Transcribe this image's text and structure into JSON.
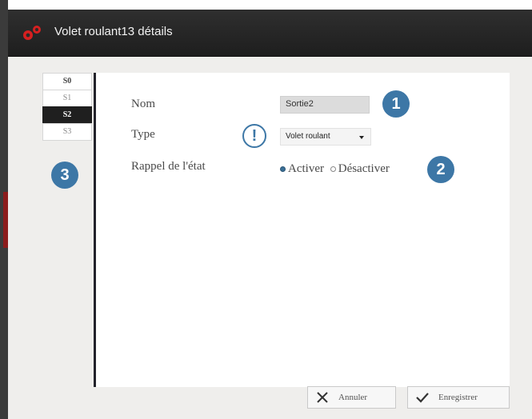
{
  "window": {
    "title": "Volet roulant13 détails"
  },
  "tabs": [
    {
      "label": "S0",
      "state": "bold"
    },
    {
      "label": "S1",
      "state": "normal"
    },
    {
      "label": "S2",
      "state": "active"
    },
    {
      "label": "S3",
      "state": "normal"
    }
  ],
  "form": {
    "name_label": "Nom",
    "name_value": "Sortie2",
    "type_label": "Type",
    "type_value": "Volet roulant",
    "state_label": "Rappel de l'état",
    "state_options": [
      "Activer",
      "Désactiver"
    ],
    "state_selected": "Activer"
  },
  "callouts": {
    "one": "1",
    "two": "2",
    "three": "3",
    "warning": "!"
  },
  "buttons": {
    "cancel": "Annuler",
    "save": "Enregistrer"
  },
  "colors": {
    "accent": "#3d77a6",
    "titlebar": "#262626",
    "logo": "#d62020"
  },
  "icons": {
    "logo": "gears-icon",
    "cancel": "close-icon",
    "save": "check-icon",
    "type_dropdown": "chevron-down-icon"
  }
}
